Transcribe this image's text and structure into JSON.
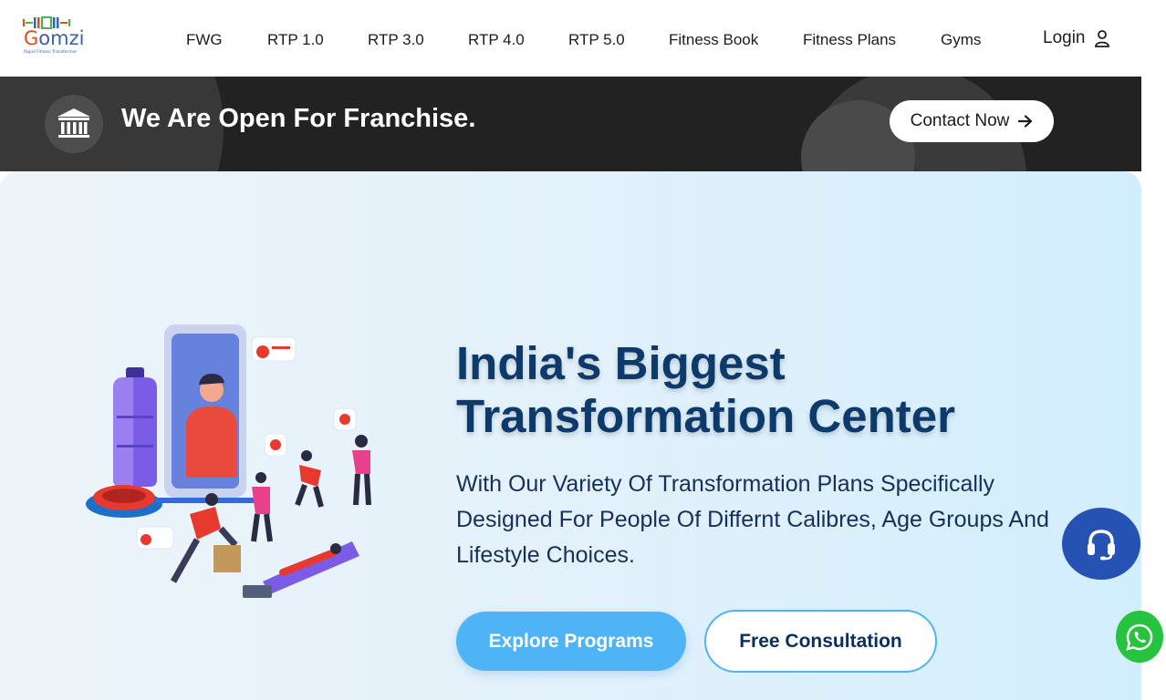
{
  "brand": {
    "name": "Gomzi",
    "tagline": "Rapid Fitness Transformer",
    "colors": {
      "accent_blue": "#3a5fb0",
      "accent_orange": "#e64a19",
      "accent_green": "#4caf50"
    }
  },
  "nav": {
    "items": [
      {
        "label": "FWG"
      },
      {
        "label": "RTP 1.0"
      },
      {
        "label": "RTP 3.0"
      },
      {
        "label": "RTP 4.0"
      },
      {
        "label": "RTP 5.0"
      },
      {
        "label": "Fitness Book"
      },
      {
        "label": "Fitness Plans"
      },
      {
        "label": "Gyms"
      }
    ],
    "login_label": "Login",
    "login_icon": "user-icon"
  },
  "franchise": {
    "icon": "bank-icon",
    "title": "We Are Open For Franchise.",
    "cta_label": "Contact Now",
    "cta_icon": "arrow-right-icon",
    "background_color": "#222222"
  },
  "hero": {
    "title_line1": "India's Biggest",
    "title_line2": "Transformation Center",
    "subtitle": "With Our Variety Of Transformation Plans Specifically Designed For People Of Differnt Calibres, Age Groups And Lifestyle Choices.",
    "primary_button": "Explore Programs",
    "secondary_button": "Free Consultation",
    "illustration": "fitness-illustration",
    "colors": {
      "title": "#0b3a6b",
      "primary_button": "#4eb4f6"
    }
  },
  "floating": {
    "support_icon": "headset-icon",
    "support_color": "#2552b3",
    "whatsapp_icon": "whatsapp-icon",
    "whatsapp_color": "#26c33e"
  }
}
